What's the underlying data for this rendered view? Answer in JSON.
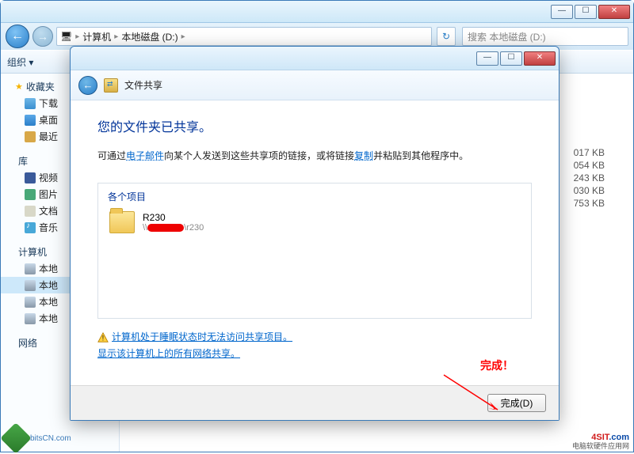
{
  "explorer": {
    "titlebar": {
      "min": "—",
      "max": "☐",
      "close": "✕"
    },
    "breadcrumb": {
      "computer": "计算机",
      "drive": "本地磁盘 (D:)"
    },
    "search_placeholder": "搜索 本地磁盘 (D:)",
    "toolbar": {
      "organize": "组织 ▾"
    },
    "sidebar": {
      "favorites": "收藏夹",
      "downloads": "下载",
      "desktop": "桌面",
      "recent": "最近",
      "libraries": "库",
      "videos": "视频",
      "pictures": "图片",
      "documents": "文档",
      "music": "音乐",
      "computer": "计算机",
      "localC": "本地",
      "localD": "本地",
      "localE": "本地",
      "localF": "本地",
      "network": "网络"
    },
    "files": {
      "s1": "017 KB",
      "s2": "054 KB",
      "s3": "243 KB",
      "s4": "030 KB",
      "s5": "753 KB"
    }
  },
  "dialog": {
    "header_title": "文件共享",
    "h1": "您的文件夹已共享。",
    "p_pre": "可通过",
    "p_link1": "电子邮件",
    "p_mid": "向某个人发送到这些共享项的链接，或将链接",
    "p_link2": "复制",
    "p_post": "并粘贴到其他程序中。",
    "items_header": "各个项目",
    "item_name": "R230",
    "item_path_prefix": "\\\\",
    "item_path_suffix": "\\r230",
    "link_sleep": "计算机处于睡眠状态时无法访问共享项目。",
    "link_showall": "显示该计算机上的所有网络共享。",
    "done_btn": "完成(D)"
  },
  "annot": {
    "text": "完成！"
  },
  "watermark": {
    "bl": "bitsCN.com",
    "br_main": "4SIT",
    "br_dot": ".com",
    "br_sub": "电脑软硬件应用网"
  }
}
